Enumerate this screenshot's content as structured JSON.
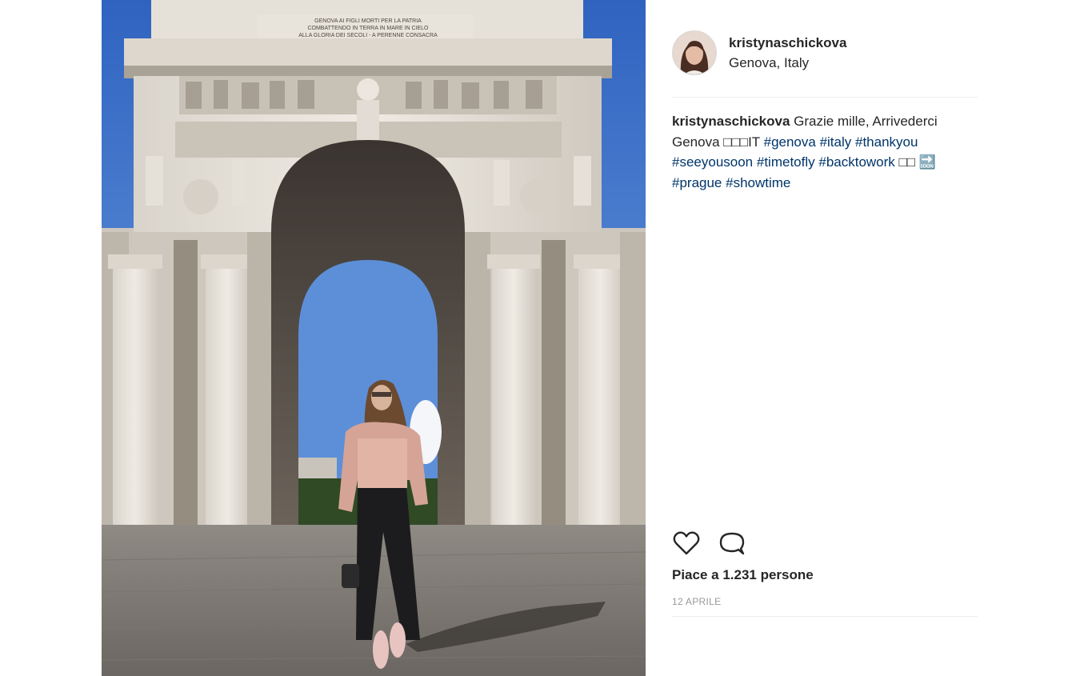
{
  "post": {
    "username": "kristynaschickova",
    "location": "Genova, Italy",
    "caption": {
      "username": "kristynaschickova",
      "text_1": " Grazie mille, Arrivederci Genova ",
      "emoji_1": "□□□IT",
      "hashtags_1": [
        "#genova",
        "#italy",
        "#thankyou",
        "#seeyousoon",
        "#timetofly",
        "#backtowork"
      ],
      "emoji_2": "□□",
      "emoji_3": "🔜",
      "hashtags_2": [
        "#prague",
        "#showtime"
      ]
    },
    "likes_text": "Piace a 1.231 persone",
    "date": "12 APRILE",
    "monument_inscription": [
      "GENOVA AI FIGLI MORTI PER LA PATRIA",
      "COMBATTENDO IN TERRA IN MARE IN CIELO",
      "ALLA GLORIA DEI SECOLI - A PERENNE CONSACRA"
    ]
  },
  "icons": {
    "like": "heart-icon",
    "comment": "comment-icon"
  },
  "colors": {
    "hashtag": "#003569",
    "text": "#262626",
    "muted": "#999999",
    "divider": "#efefef"
  }
}
